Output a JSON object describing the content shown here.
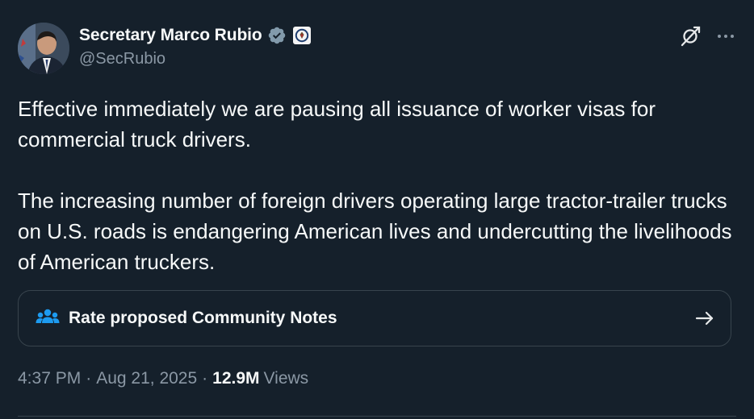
{
  "author": {
    "display_name": "Secretary Marco Rubio",
    "handle": "@SecRubio",
    "verified_badge_color": "#829aab"
  },
  "tweet": {
    "paragraphs": [
      "Effective immediately we are pausing all issuance of worker visas for commercial truck drivers.",
      "The increasing number of foreign drivers operating large tractor-trailer trucks on U.S. roads is endangering American lives and undercutting the livelihoods of American truckers."
    ]
  },
  "community_notes": {
    "label": "Rate proposed Community Notes",
    "icon": "people-icon",
    "icon_color": "#1d9bf0"
  },
  "meta": {
    "time": "4:37 PM",
    "separator": "·",
    "date": "Aug 21, 2025",
    "views_count": "12.9M",
    "views_label": "Views"
  },
  "colors": {
    "background": "#15202b",
    "text": "#f7f9f9",
    "secondary_text": "#8b98a5",
    "border": "#38444d"
  }
}
